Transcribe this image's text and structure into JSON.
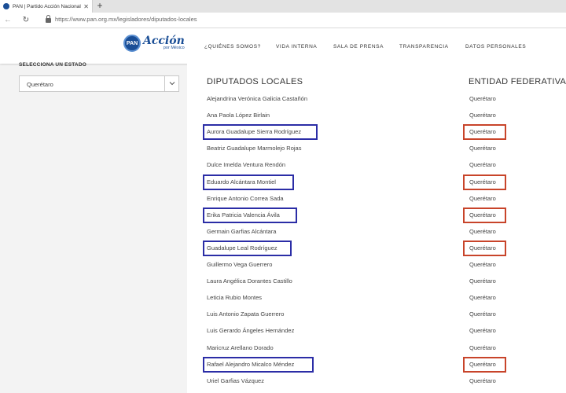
{
  "browser": {
    "tab_title": "PAN | Partido Acción Nacional",
    "tab_close": "✕",
    "new_tab": "+",
    "url": "https://www.pan.org.mx/legisladores/diputados-locales"
  },
  "header": {
    "logo_badge": "PAN",
    "logo_word": "Acción",
    "logo_tagline": "por México",
    "menu": [
      "¿QUIÉNES SOMOS?",
      "VIDA INTERNA",
      "SALA DE PRENSA",
      "TRANSPARENCIA",
      "DATOS PERSONALES"
    ]
  },
  "sidebar": {
    "label": "SELECCIONA UN ESTADO",
    "selected": "Querétaro"
  },
  "table": {
    "col_name": "DIPUTADOS LOCALES",
    "col_entity": "ENTIDAD FEDERATIVA",
    "rows": [
      {
        "name": "Alejandrina Verónica Galicia Castañón",
        "entity": "Querétaro",
        "highlighted": false
      },
      {
        "name": "Ana Paola López Birlain",
        "entity": "Querétaro",
        "highlighted": false
      },
      {
        "name": "Aurora Guadalupe Sierra Rodríguez",
        "entity": "Querétaro",
        "highlighted": true
      },
      {
        "name": "Beatriz Guadalupe Marmolejo Rojas",
        "entity": "Querétaro",
        "highlighted": false
      },
      {
        "name": "Dulce Imelda Ventura Rendón",
        "entity": "Querétaro",
        "highlighted": false
      },
      {
        "name": "Eduardo Alcántara Montiel",
        "entity": "Querétaro",
        "highlighted": true
      },
      {
        "name": "Enrique Antonio Correa Sada",
        "entity": "Querétaro",
        "highlighted": false
      },
      {
        "name": "Erika Patricia Valencia Ávila",
        "entity": "Querétaro",
        "highlighted": true
      },
      {
        "name": "Germain Garfias Alcántara",
        "entity": "Querétaro",
        "highlighted": false
      },
      {
        "name": "Guadalupe Leal Rodríguez",
        "entity": "Querétaro",
        "highlighted": true
      },
      {
        "name": "Guillermo Vega Guerrero",
        "entity": "Querétaro",
        "highlighted": false
      },
      {
        "name": "Laura Angélica Dorantes Castillo",
        "entity": "Querétaro",
        "highlighted": false
      },
      {
        "name": "Leticia Rubio Montes",
        "entity": "Querétaro",
        "highlighted": false
      },
      {
        "name": "Luis Antonio Zapata Guerrero",
        "entity": "Querétaro",
        "highlighted": false
      },
      {
        "name": "Luis Gerardo Ángeles Hernández",
        "entity": "Querétaro",
        "highlighted": false
      },
      {
        "name": "Maricruz Arellano Dorado",
        "entity": "Querétaro",
        "highlighted": false
      },
      {
        "name": "Rafael Alejandro Micalco Méndez",
        "entity": "Querétaro",
        "highlighted": true
      },
      {
        "name": "Uriel Garfias Vázquez",
        "entity": "Querétaro",
        "highlighted": false
      }
    ]
  },
  "colors": {
    "brand_blue": "#1a4e96",
    "highlight_blue": "#2b2da6",
    "highlight_red": "#c8442a"
  }
}
